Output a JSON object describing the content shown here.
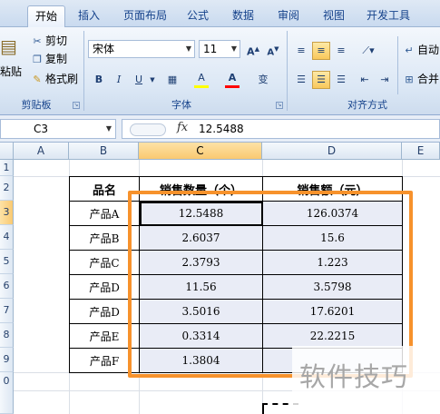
{
  "tabs": [
    "开始",
    "插入",
    "页面布局",
    "公式",
    "数据",
    "审阅",
    "视图",
    "开发工具"
  ],
  "clipboard": {
    "paste": "粘贴",
    "cut": "剪切",
    "copy": "复制",
    "format_painter": "格式刷",
    "group_label": "剪贴板"
  },
  "font": {
    "name": "宋体",
    "size": "11",
    "grow": "A",
    "shrink": "A",
    "bold": "B",
    "italic": "I",
    "underline": "U",
    "fill_glyph": "A",
    "color_glyph": "A",
    "phonetic": "变",
    "group_label": "字体",
    "fill_color": "#ffff00",
    "font_color": "#ff0000"
  },
  "alignment": {
    "wrap": "自动",
    "merge": "合并",
    "group_label": "对齐方式"
  },
  "formula_bar": {
    "name_box": "C3",
    "fx": "fx",
    "value": "12.5488"
  },
  "columns": [
    "A",
    "B",
    "C",
    "D",
    "E"
  ],
  "rows": [
    "1",
    "2",
    "3",
    "4",
    "5",
    "6",
    "7",
    "8",
    "9",
    "0"
  ],
  "table": {
    "headers": [
      "品名",
      "销售数量（个）",
      "销售额（元）"
    ],
    "rows": [
      [
        "产品A",
        "12.5488",
        "126.0374"
      ],
      [
        "产品B",
        "2.6037",
        "15.6"
      ],
      [
        "产品C",
        "2.3793",
        "1.223"
      ],
      [
        "产品D",
        "11.56",
        "3.5798"
      ],
      [
        "产品D",
        "3.5016",
        "17.6201"
      ],
      [
        "产品E",
        "0.3314",
        "22.2215"
      ],
      [
        "产品F",
        "1.3804",
        ""
      ]
    ]
  },
  "watermark": "软件技巧",
  "colors": {
    "highlight_box": "#f7922c",
    "ribbon": "#dbe7f5",
    "selected_header": "#f9c971"
  }
}
